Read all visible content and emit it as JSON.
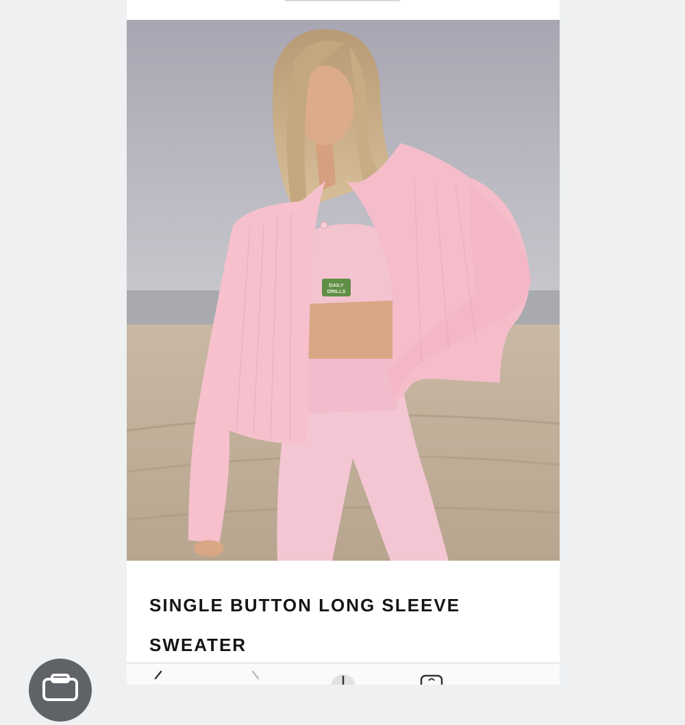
{
  "product": {
    "title": "SINGLE BUTTON LONG SLEEVE SWEATER",
    "image_badge_text": "DAILY DRILLS"
  },
  "browser": {
    "back_icon": "chevron-left-icon",
    "forward_icon": "chevron-right-icon",
    "share_icon": "share-icon",
    "tabs_icon": "tabs-icon"
  },
  "overlay": {
    "icon": "camera-icon"
  },
  "colors": {
    "background": "#eef0f2",
    "card": "#ffffff",
    "title_text": "#151515",
    "fab": "#5f6368"
  }
}
